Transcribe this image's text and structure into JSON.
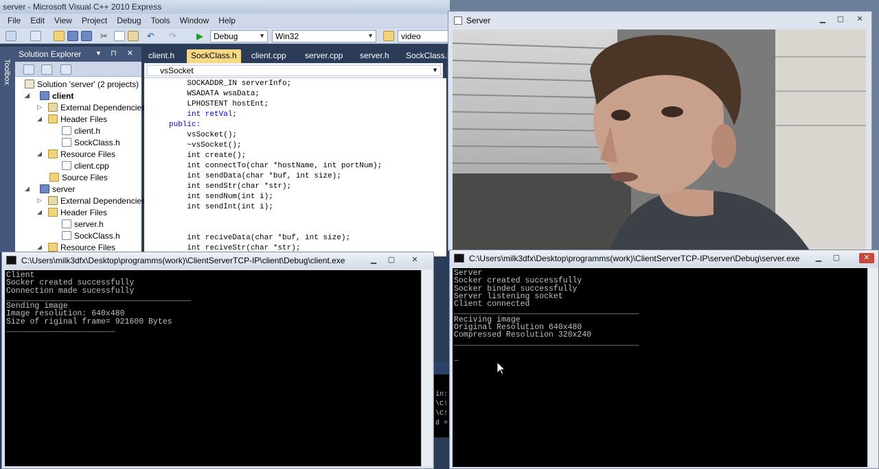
{
  "vs": {
    "title": "server - Microsoft Visual C++ 2010 Express",
    "menu": [
      "File",
      "Edit",
      "View",
      "Project",
      "Debug",
      "Tools",
      "Window",
      "Help"
    ],
    "toolbar": {
      "config": "Debug",
      "platform": "Win32",
      "find": "video"
    },
    "solution_explorer": {
      "title": "Solution Explorer",
      "toolbox_label": "Toolbox",
      "items": [
        {
          "label": "Solution 'server' (2 projects)"
        },
        {
          "label": "client"
        },
        {
          "label": "External Dependencies"
        },
        {
          "label": "Header Files"
        },
        {
          "label": "client.h"
        },
        {
          "label": "SockClass.h"
        },
        {
          "label": "Resource Files"
        },
        {
          "label": "client.cpp"
        },
        {
          "label": "Source Files"
        },
        {
          "label": "server"
        },
        {
          "label": "External Dependencies"
        },
        {
          "label": "Header Files"
        },
        {
          "label": "server.h"
        },
        {
          "label": "SockClass.h"
        },
        {
          "label": "Resource Files"
        }
      ]
    },
    "tabs": [
      "client.h",
      "SockClass.h",
      "client.cpp",
      "server.cpp",
      "server.h",
      "SockClass.h"
    ],
    "nav_combo": "vsSocket",
    "code": [
      "    SOCKADDR_IN serverInfo;",
      "    WSADATA wsaData;",
      "    LPHOSTENT hostEnt;",
      "    int retVal;",
      "public:",
      "    vsSocket();",
      "    ~vsSocket();",
      "    int create();",
      "    int connectTo(char *hostName, int portNum);",
      "    int sendData(char *buf, int size);",
      "    int sendStr(char *str);",
      "    int sendNum(int i);",
      "    int sendInt(int i);",
      "",
      "",
      "    int reciveData(char *buf, int size);",
      "    int reciveStr(char *str);"
    ]
  },
  "server_window": {
    "title": "Server"
  },
  "client_console": {
    "title": "C:\\Users\\milk3dfx\\Desktop\\programms(work)\\ClientServerTCP-IP\\client\\Debug\\client.exe",
    "output": "Client\nSocker created successfully\nConnection made sucessfully\n_______________________________________\nSending image\nImage resolution: 640x480\nSize of riginal frame= 921600 Bytes\n_______________________"
  },
  "server_console": {
    "title": "C:\\Users\\milk3dfx\\Desktop\\programms(work)\\ClientServerTCP-IP\\server\\Debug\\server.exe",
    "output": "Server\nSocker created successfully\nSocker binded successfully\nServer listening socket\nClient connected\n_______________________________________\nReciving image\nOriginal Resolution 640x480\nCompressed Resolution 320x240\n_______________________________________\n\n_"
  },
  "peek_console": {
    "lines": [
      "in:",
      "\\C!",
      "\\C!",
      "d ="
    ]
  }
}
